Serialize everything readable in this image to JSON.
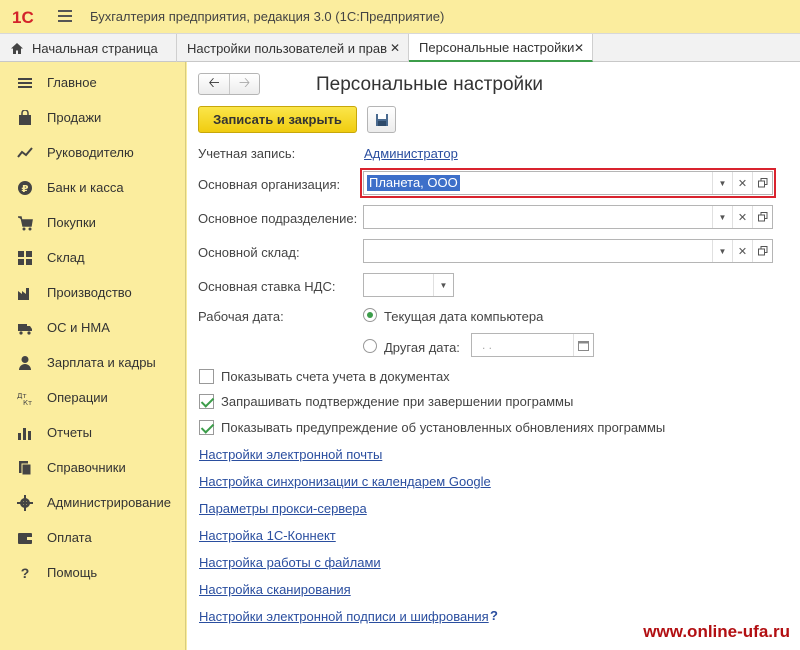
{
  "app": {
    "logo_text": "1С",
    "title": "Бухгалтерия предприятия, редакция 3.0 (1С:Предприятие)"
  },
  "tabs": [
    {
      "label": "Начальная страница",
      "icon": "home-icon"
    },
    {
      "label": "Настройки пользователей и прав",
      "close": "✕"
    },
    {
      "label": "Персональные настройки",
      "close": "✕",
      "active": true
    }
  ],
  "sidebar": {
    "items": [
      {
        "label": "Главное",
        "icon": "menu-lines-icon"
      },
      {
        "label": "Продажи",
        "icon": "shopping-bag-icon"
      },
      {
        "label": "Руководителю",
        "icon": "trend-line-icon"
      },
      {
        "label": "Банк и касса",
        "icon": "ruble-coin-icon"
      },
      {
        "label": "Покупки",
        "icon": "cart-icon"
      },
      {
        "label": "Склад",
        "icon": "grid-icon"
      },
      {
        "label": "Производство",
        "icon": "factory-icon"
      },
      {
        "label": "ОС и НМА",
        "icon": "truck-icon"
      },
      {
        "label": "Зарплата и кадры",
        "icon": "person-icon"
      },
      {
        "label": "Операции",
        "icon": "dt-kt-icon"
      },
      {
        "label": "Отчеты",
        "icon": "bar-chart-icon"
      },
      {
        "label": "Справочники",
        "icon": "books-icon"
      },
      {
        "label": "Администрирование",
        "icon": "gear-icon"
      },
      {
        "label": "Оплата",
        "icon": "wallet-icon"
      },
      {
        "label": "Помощь",
        "icon": "question-icon"
      }
    ]
  },
  "main": {
    "title": "Персональные настройки",
    "save_button": "Записать и закрыть",
    "account_label": "Учетная запись:",
    "account_value": "Администратор",
    "org_label": "Основная организация:",
    "org_value": "Планета, ООО",
    "division_label": "Основное подразделение:",
    "warehouse_label": "Основной склад:",
    "vat_label": "Основная ставка НДС:",
    "workdate_label": "Рабочая дата:",
    "radio_current": "Текущая дата компьютера",
    "radio_other": "Другая дата:",
    "date_placeholder": ".  .",
    "checkboxes": [
      {
        "label": "Показывать счета учета в документах",
        "checked": false
      },
      {
        "label": "Запрашивать подтверждение при завершении программы",
        "checked": true
      },
      {
        "label": "Показывать предупреждение об установленных обновлениях программы",
        "checked": true
      }
    ],
    "links": [
      "Настройки электронной почты",
      "Настройка синхронизации с календарем Google",
      "Параметры прокси-сервера",
      "Настройка 1С-Коннект",
      "Настройка работы с файлами",
      "Настройка сканирования",
      "Настройки электронной подписи и шифрования"
    ],
    "help_mark": "?"
  },
  "watermark": "www.online-ufa.ru",
  "colors": {
    "accent_green": "#3c9d4a",
    "highlight_red": "#d9232e",
    "save_yellow": "#f5d826",
    "link_blue": "#2a4e9f",
    "sidebar_bg": "#fbed9e"
  }
}
